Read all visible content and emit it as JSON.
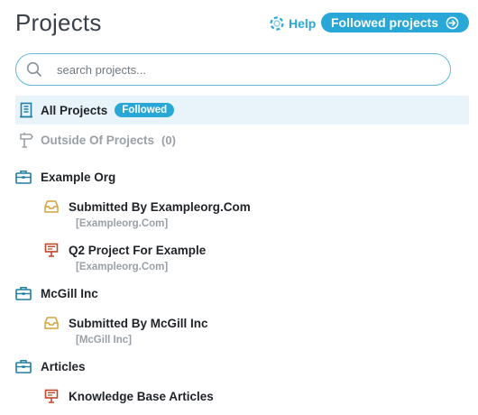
{
  "header": {
    "title": "Projects",
    "help_label": "Help",
    "followed_projects_label": "Followed projects"
  },
  "search": {
    "placeholder": "search projects..."
  },
  "colors": {
    "accent": "#29a8d8",
    "org_icon": "#1f7fa3",
    "inbox_icon": "#d4a23c",
    "project_icon": "#c0472c"
  },
  "nav": {
    "all_projects": {
      "label": "All Projects",
      "badge": "Followed",
      "icon": "building-icon"
    },
    "outside_projects": {
      "label": "Outside Of Projects",
      "count": "(0)",
      "icon": "signpost-icon"
    }
  },
  "tree": [
    {
      "type": "org",
      "icon": "briefcase-icon",
      "label": "Example Org"
    },
    {
      "type": "inbox",
      "icon": "inbox-icon",
      "label": "Submitted By Exampleorg.Com",
      "sub": "[Exampleorg.Com]"
    },
    {
      "type": "project",
      "icon": "presentation-board-icon",
      "label": "Q2 Project For Example",
      "sub": "[Exampleorg.Com]"
    },
    {
      "type": "org",
      "icon": "briefcase-icon",
      "label": "McGill Inc"
    },
    {
      "type": "inbox",
      "icon": "inbox-icon",
      "label": "Submitted By McGill Inc",
      "sub": "[McGill Inc]"
    },
    {
      "type": "org",
      "icon": "briefcase-icon",
      "label": "Articles"
    },
    {
      "type": "project",
      "icon": "presentation-board-icon",
      "label": "Knowledge Base Articles"
    }
  ]
}
